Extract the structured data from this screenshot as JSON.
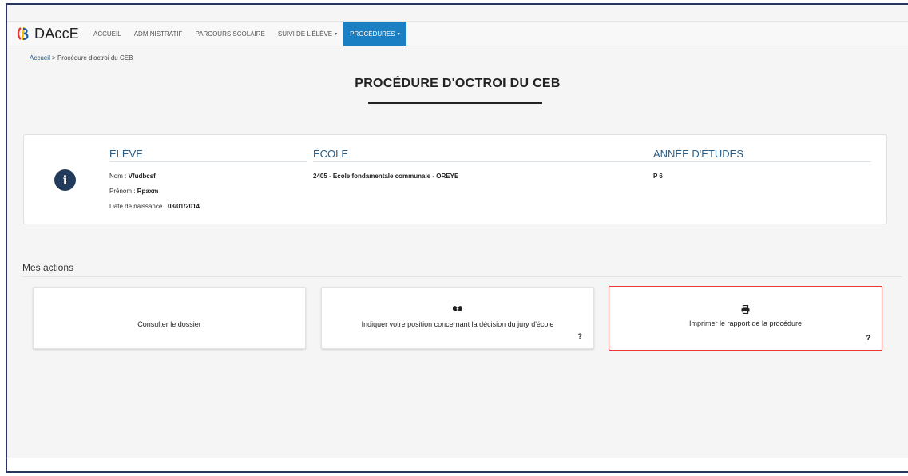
{
  "brand": {
    "name": "DAccE"
  },
  "nav": {
    "items": [
      {
        "label": "ACCUEIL",
        "caret": ""
      },
      {
        "label": "ADMINISTRATIF",
        "caret": ""
      },
      {
        "label": "PARCOURS SCOLAIRE",
        "caret": ""
      },
      {
        "label": "SUIVI DE L'ÉLÈVE",
        "caret": "▾"
      },
      {
        "label": "PROCÉDURES",
        "caret": "▾"
      }
    ],
    "active_index": 4
  },
  "breadcrumb": {
    "home": "Accueil",
    "separator": ">",
    "current": "Procédure d'octroi du CEB"
  },
  "page": {
    "title": "PROCÉDURE D'OCTROI DU CEB"
  },
  "student": {
    "icon": "info-icon",
    "eleve_heading": "ÉLÈVE",
    "nom_label": "Nom :",
    "nom_value": "Vfudbcsf",
    "prenom_label": "Prénom :",
    "prenom_value": "Rpaxm",
    "dob_label": "Date de naissance :",
    "dob_value": "03/01/2014",
    "ecole_heading": "ÉCOLE",
    "ecole_value": "2405 - Ecole fondamentale communale - OREYE",
    "annee_heading": "ANNÉE D'ÉTUDES",
    "annee_value": "P 6"
  },
  "actions": {
    "title": "Mes actions",
    "items": [
      {
        "label": "Consulter le dossier",
        "icon": "",
        "help": ""
      },
      {
        "label": "Indiquer votre position concernant la décision du jury d'école",
        "icon": "handshake-icon",
        "help": "?"
      },
      {
        "label": "Imprimer le rapport de la procédure",
        "icon": "print-icon",
        "help": "?"
      }
    ]
  },
  "colors": {
    "accent": "#1b7fc4",
    "heading": "#2b5e86",
    "highlight": "#e53935",
    "frame": "#2a3560"
  }
}
